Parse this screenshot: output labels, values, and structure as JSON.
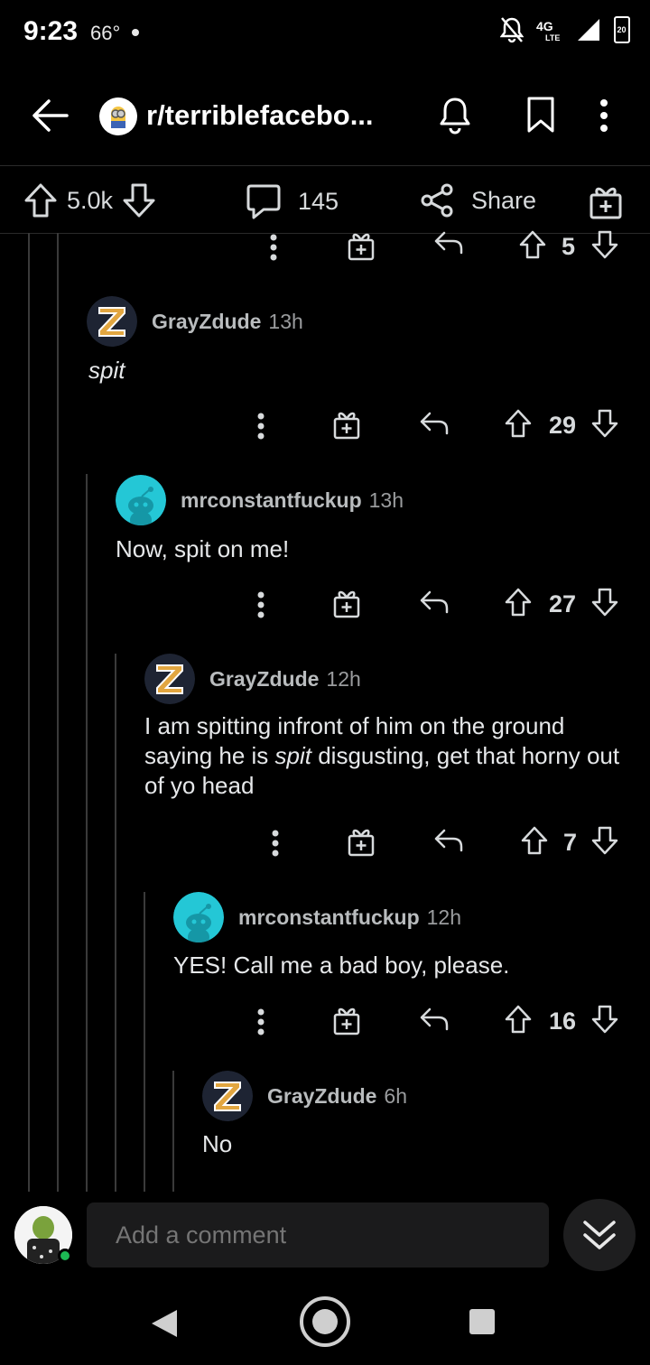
{
  "status": {
    "time": "9:23",
    "temp": "66°",
    "battery": "20"
  },
  "header": {
    "subreddit": "r/terriblefacebo..."
  },
  "post_actions": {
    "upvotes": "5.0k",
    "comments": "145",
    "share_label": "Share"
  },
  "comments": [
    {
      "votes": "5"
    },
    {
      "author": "GrayZdude",
      "age": "13h",
      "text": "spit",
      "votes": "29"
    },
    {
      "author": "mrconstantfuckup",
      "age": "13h",
      "text": "Now, spit on me!",
      "votes": "27"
    },
    {
      "author": "GrayZdude",
      "age": "12h",
      "text_parts": [
        "I am spitting infront of him on the ground saying he is ",
        "spit",
        " disgusting, get that horny out of yo head"
      ],
      "votes": "7"
    },
    {
      "author": "mrconstantfuckup",
      "age": "12h",
      "text": "YES! Call me a bad boy, please.",
      "votes": "16"
    },
    {
      "author": "GrayZdude",
      "age": "6h",
      "text": "No"
    }
  ],
  "composer": {
    "placeholder": "Add a comment"
  },
  "colors": {
    "background": "#000000",
    "thread_line": "#3a3a3a",
    "snoo_teal": "#24c7d6",
    "online": "#1db954"
  }
}
